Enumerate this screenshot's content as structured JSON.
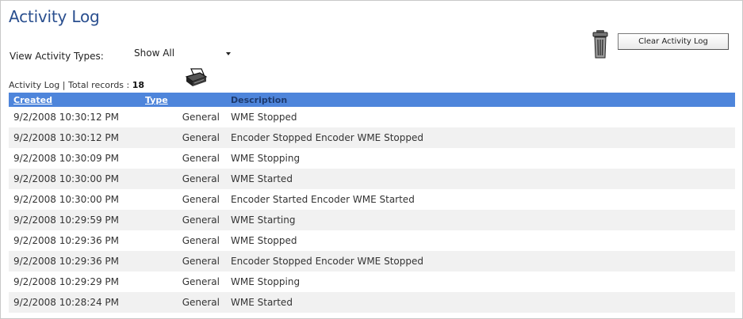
{
  "page": {
    "title": "Activity Log"
  },
  "filter": {
    "label": "View Activity Types:",
    "selected": "Show All"
  },
  "actions": {
    "clear_label": "Clear Activity Log",
    "trash_icon": "trash-can-icon",
    "print_icon": "printer-icon"
  },
  "summary": {
    "prefix": "Activity Log | Total records :",
    "count": "18"
  },
  "table": {
    "columns": [
      "Created",
      "Type",
      "Description"
    ],
    "header_color": "#4e85db",
    "rows": [
      [
        "9/2/2008 10:30:12 PM",
        "General",
        "WME Stopped"
      ],
      [
        "9/2/2008 10:30:12 PM",
        "General",
        "Encoder Stopped Encoder WME Stopped"
      ],
      [
        "9/2/2008 10:30:09 PM",
        "General",
        "WME Stopping"
      ],
      [
        "9/2/2008 10:30:00 PM",
        "General",
        "WME Started"
      ],
      [
        "9/2/2008 10:30:00 PM",
        "General",
        "Encoder Started Encoder WME Started"
      ],
      [
        "9/2/2008 10:29:59 PM",
        "General",
        "WME Starting"
      ],
      [
        "9/2/2008 10:29:36 PM",
        "General",
        "WME Stopped"
      ],
      [
        "9/2/2008 10:29:36 PM",
        "General",
        "Encoder Stopped Encoder WME Stopped"
      ],
      [
        "9/2/2008 10:29:29 PM",
        "General",
        "WME Stopping"
      ],
      [
        "9/2/2008 10:28:24 PM",
        "General",
        "WME Started"
      ]
    ]
  }
}
